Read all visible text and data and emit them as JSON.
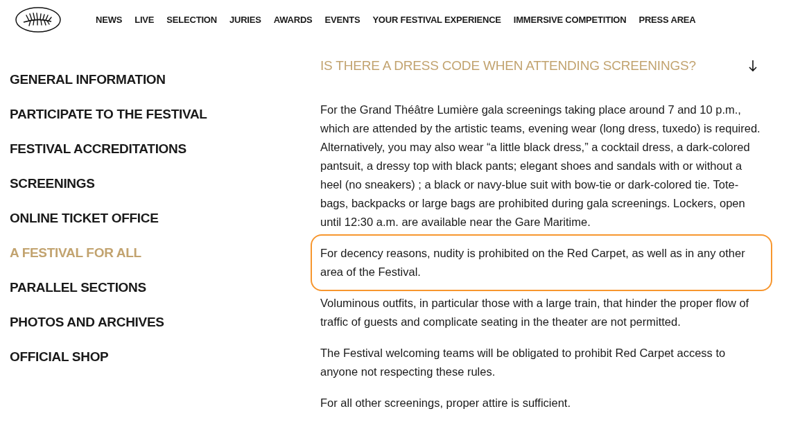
{
  "header": {
    "nav": [
      "NEWS",
      "LIVE",
      "SELECTION",
      "JURIES",
      "AWARDS",
      "EVENTS",
      "YOUR FESTIVAL EXPERIENCE",
      "IMMERSIVE COMPETITION",
      "PRESS AREA"
    ]
  },
  "sidebar": {
    "items": [
      {
        "label": "GENERAL INFORMATION",
        "selected": false
      },
      {
        "label": "PARTICIPATE TO THE FESTIVAL",
        "selected": false
      },
      {
        "label": "FESTIVAL ACCREDITATIONS",
        "selected": false
      },
      {
        "label": "SCREENINGS",
        "selected": false
      },
      {
        "label": "ONLINE TICKET OFFICE",
        "selected": false
      },
      {
        "label": "A FESTIVAL FOR ALL",
        "selected": true
      },
      {
        "label": "PARALLEL SECTIONS",
        "selected": false
      },
      {
        "label": "PHOTOS AND ARCHIVES",
        "selected": false
      },
      {
        "label": "OFFICIAL SHOP",
        "selected": false
      }
    ]
  },
  "faq": {
    "question": "IS THERE A DRESS CODE WHEN ATTENDING SCREENINGS?",
    "expanded": true,
    "paragraphs": [
      {
        "text": "For the Grand Théâtre Lumière gala screenings taking place around 7 and 10 p.m., which are attended by the artistic teams, evening wear (long dress, tuxedo) is required. Alternatively, you may also wear “a little black dress,” a cocktail dress, a dark-colored pantsuit, a dressy top with black pants; elegant shoes and sandals with or without a heel (no sneakers) ; a black or navy-blue suit with bow-tie or dark-colored tie. Tote-bags, backpacks or large bags are prohibited during gala screenings. Lockers, open until 12:30 a.m. are available near the Gare Maritime.",
        "highlighted": false
      },
      {
        "text": "For decency reasons, nudity is prohibited on the Red Carpet, as well as in any other area of the Festival.",
        "highlighted": true
      },
      {
        "text": "Voluminous outfits, in particular those with a large train, that hinder the proper flow of traffic of guests and complicate seating in the theater are not permitted.",
        "highlighted": false
      },
      {
        "text": "The Festival welcoming teams will be obligated to prohibit Red Carpet access to anyone not respecting these rules.",
        "highlighted": false
      },
      {
        "text": "For all other screenings, proper attire is sufficient.",
        "highlighted": false
      }
    ]
  }
}
